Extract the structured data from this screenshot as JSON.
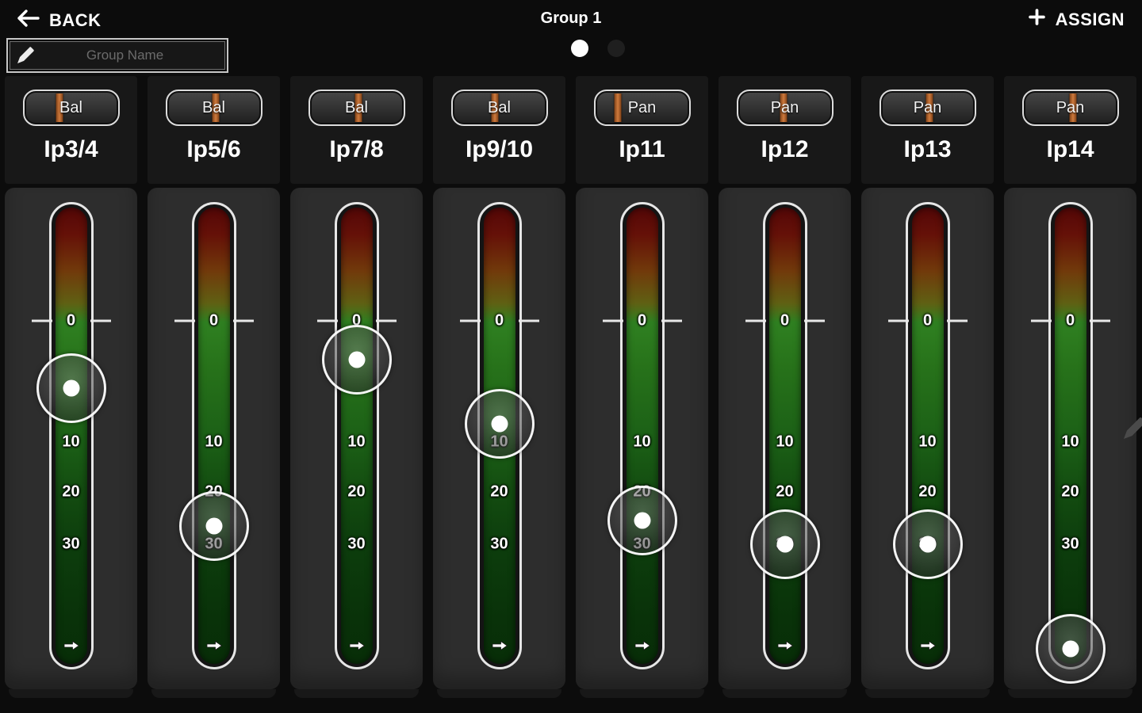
{
  "header": {
    "back_label": "BACK",
    "title": "Group 1",
    "assign_label": "ASSIGN",
    "group_name": {
      "placeholder": "Group Name",
      "value": ""
    },
    "page_dots": [
      {
        "state": "active"
      },
      {
        "state": "inactive"
      }
    ]
  },
  "fader_scale": {
    "marks": [
      {
        "label": "0",
        "pos": 0.251,
        "ticks": true
      },
      {
        "label": "10",
        "pos": 0.514,
        "ticks": false
      },
      {
        "label": "20",
        "pos": 0.622,
        "ticks": false
      },
      {
        "label": "30",
        "pos": 0.734,
        "ticks": false
      }
    ],
    "min_arrow_pos": 0.954
  },
  "channels": [
    {
      "label": "Ip3/4",
      "mode": "Bal",
      "pan_pos": 0.38,
      "fader_pos": 0.398
    },
    {
      "label": "Ip5/6",
      "mode": "Bal",
      "pan_pos": 0.52,
      "fader_pos": 0.695
    },
    {
      "label": "Ip7/8",
      "mode": "Bal",
      "pan_pos": 0.52,
      "fader_pos": 0.336
    },
    {
      "label": "Ip9/10",
      "mode": "Bal",
      "pan_pos": 0.45,
      "fader_pos": 0.475
    },
    {
      "label": "Ip11",
      "mode": "Pan",
      "pan_pos": 0.24,
      "fader_pos": 0.683
    },
    {
      "label": "Ip12",
      "mode": "Pan",
      "pan_pos": 0.49,
      "fader_pos": 0.734
    },
    {
      "label": "Ip13",
      "mode": "Pan",
      "pan_pos": 0.52,
      "fader_pos": 0.734
    },
    {
      "label": "Ip14",
      "mode": "Pan",
      "pan_pos": 0.53,
      "fader_pos": 0.961
    }
  ],
  "colors": {
    "accent_orange": "#cf7a3d",
    "meter_red_top": "#540707",
    "meter_green_zero": "#2f8021",
    "meter_green_bottom": "#082e08",
    "header_panel": "#181818",
    "fader_panel": "#2d2d2d",
    "page_bg": "#0c0c0c"
  }
}
